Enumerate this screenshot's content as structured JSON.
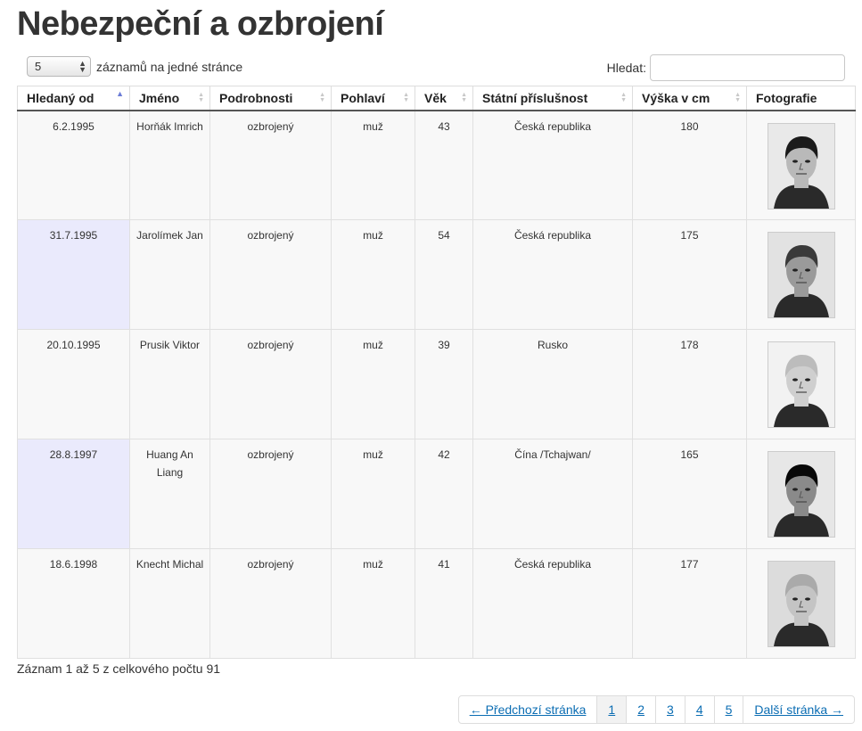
{
  "page": {
    "title": "Nebezpeční a ozbrojení"
  },
  "length": {
    "value": "5",
    "label": "záznamů na jedné stránce"
  },
  "search": {
    "label": "Hledat:",
    "value": "",
    "placeholder": ""
  },
  "table": {
    "columns": [
      "Hledaný od",
      "Jméno",
      "Podrobnosti",
      "Pohlaví",
      "Věk",
      "Státní příslušnost",
      "Výška v cm",
      "Fotografie"
    ],
    "sorted_column": "Hledaný od",
    "sort_direction": "ascending",
    "rows": [
      {
        "date": "6.2.1995",
        "name": "Horňák Imrich",
        "details": "ozbrojený",
        "gender": "muž",
        "age": "43",
        "nationality": "Česká republika",
        "height": "180",
        "photo": "photo-portrait"
      },
      {
        "date": "31.7.1995",
        "name": "Jarolímek Jan",
        "details": "ozbrojený",
        "gender": "muž",
        "age": "54",
        "nationality": "Česká republika",
        "height": "175",
        "photo": "photo-portrait"
      },
      {
        "date": "20.10.1995",
        "name": "Prusik Viktor",
        "details": "ozbrojený",
        "gender": "muž",
        "age": "39",
        "nationality": "Rusko",
        "height": "178",
        "photo": "photo-portrait"
      },
      {
        "date": "28.8.1997",
        "name": "Huang An Liang",
        "details": "ozbrojený",
        "gender": "muž",
        "age": "42",
        "nationality": "Čína /Tchajwan/",
        "height": "165",
        "photo": "photo-portrait"
      },
      {
        "date": "18.6.1998",
        "name": "Knecht Michal",
        "details": "ozbrojený",
        "gender": "muž",
        "age": "41",
        "nationality": "Česká republika",
        "height": "177",
        "photo": "photo-portrait"
      }
    ]
  },
  "info": "Záznam 1 až 5 z celkového počtu 91",
  "pagination": {
    "prev": "← Předchozí stránka",
    "pages": [
      "1",
      "2",
      "3",
      "4",
      "5"
    ],
    "current": "1",
    "next": "Další stránka →"
  },
  "colors": {
    "link": "#0b6db3",
    "sorted_cell": "#eaeafc",
    "sort_active": "#6b7cd6"
  }
}
